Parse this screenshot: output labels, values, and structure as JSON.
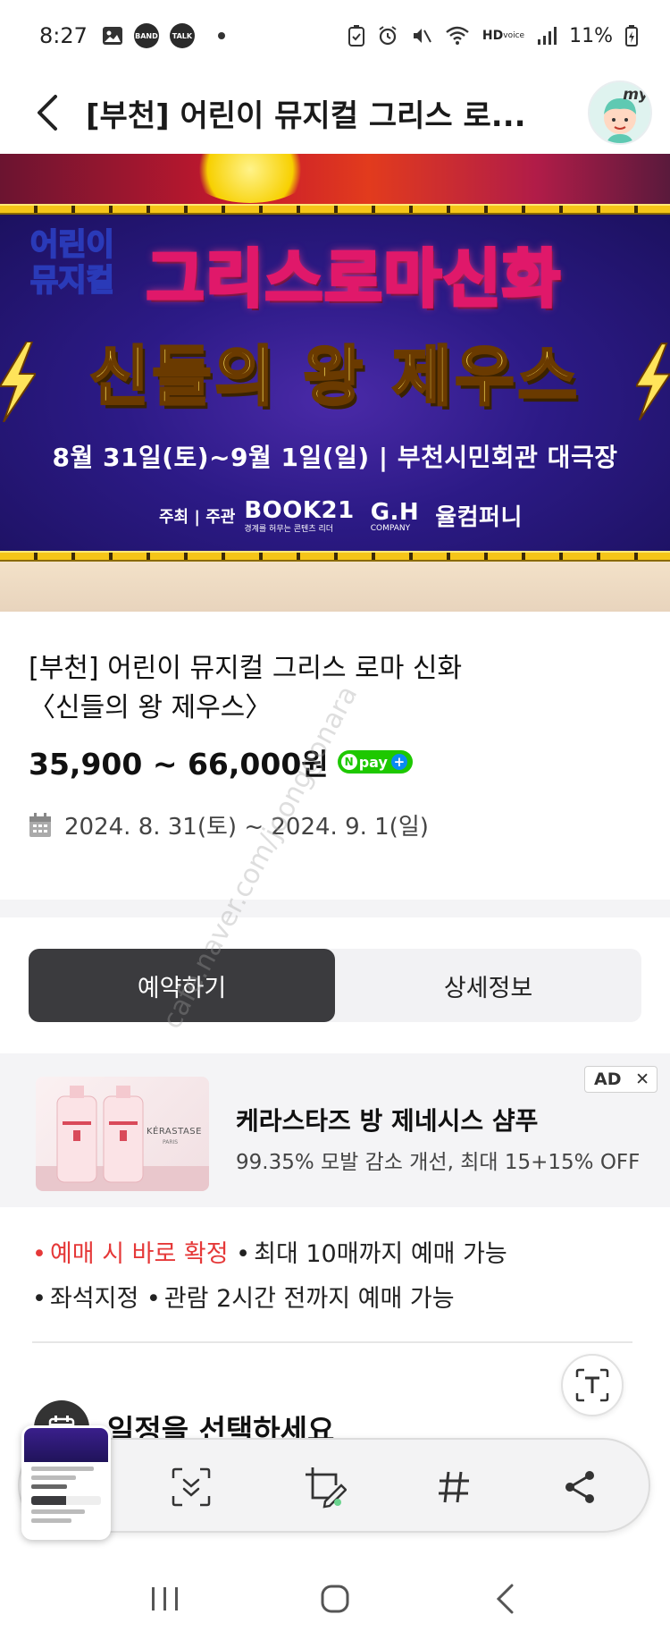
{
  "status_bar": {
    "time": "8:27",
    "app_badges": [
      "BAND",
      "TALK"
    ],
    "network_label_top": "HD",
    "network_label_bottom": "voice",
    "battery_text": "11%"
  },
  "header": {
    "title": "[부천] 어린이 뮤지컬 그리스 로...",
    "avatar_label": "my"
  },
  "poster": {
    "kids_label_line1": "어린이",
    "kids_label_line2": "뮤지컬",
    "main_title": "그리스로마신화",
    "sub_title": "신들의 왕 제우스",
    "date_venue": "8월 31일(토)~9월 1일(일) | 부천시민회관 대극장",
    "org_label": "주최 | 주관",
    "org1": "BOOK21",
    "org1_small": "경계를 허무는 콘텐츠 리더",
    "org2": "G.H",
    "org2_small": "COMPANY",
    "org3": "율컴퍼니"
  },
  "product": {
    "title_line1": "[부천] 어린이 뮤지컬 그리스 로마 신화",
    "title_line2": "〈신들의 왕 제우스〉",
    "price": "35,900 ~ 66,000원",
    "npay_label": "pay",
    "npay_n": "N",
    "npay_plus": "+",
    "period": "2024. 8. 31(토) ~ 2024. 9. 1(일)"
  },
  "tabs": [
    {
      "label": "예약하기",
      "active": true
    },
    {
      "label": "상세정보",
      "active": false
    }
  ],
  "ad": {
    "badge": "AD",
    "close": "✕",
    "title": "케라스타즈 방 제네시스 샴푸",
    "description": "99.35% 모발 감소 개선, 최대 15+15% OFF",
    "brand": "KÉRASTASE",
    "brand_sub": "PARIS"
  },
  "notes": {
    "line1_red": "예매 시 바로 확정",
    "line1_rest": "최대 10매까지 예매 가능",
    "line2_a": "좌석지정",
    "line2_b": "관람 2시간 전까지 예매 가능",
    "bullet": "•"
  },
  "schedule": {
    "title": "일정을 선택하세요"
  },
  "colors": {
    "accent_red": "#e53838",
    "tab_active_bg": "#3b3b3e",
    "npay_green": "#1ec800"
  },
  "icons": {
    "back": "chevron-left-icon",
    "calendar": "calendar-icon",
    "text_scan": "text-extract-icon",
    "scroll_capture": "scroll-capture-icon",
    "edit": "crop-edit-icon",
    "tag": "hashtag-icon",
    "share": "share-icon"
  },
  "watermark": "cafe.naver.com/joonggonara"
}
